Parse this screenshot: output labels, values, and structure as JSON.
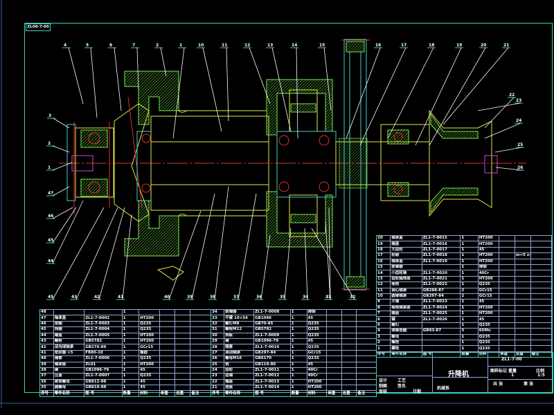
{
  "drawing_number_tag": "ZL00-7-00",
  "colors": {
    "background": "#000000",
    "frame": "#3fd0c8",
    "section_hatch": "#7de84c",
    "outline": "#e8e84c",
    "centerline": "#e03030",
    "grid": "#8ea8d8"
  },
  "callouts": [
    "4",
    "5",
    "6",
    "7",
    "2",
    "1",
    "10",
    "11",
    "12",
    "13",
    "14",
    "15",
    "16",
    "17",
    "18",
    "19",
    "20",
    "21",
    "22",
    "23",
    "24",
    "25",
    "26",
    "3",
    "2",
    "1",
    "47",
    "46",
    "45",
    "44",
    "45",
    "43",
    "42",
    "41",
    "40",
    "39",
    "38",
    "37",
    "36",
    "35",
    "34",
    "33",
    "32",
    "31"
  ],
  "parts_table_left": {
    "rows": [
      [
        "48",
        "",
        "",
        "1",
        "",
        "",
        ""
      ],
      [
        "47",
        "轴承盖",
        "ZL1-7-0002",
        "1",
        "HT200",
        "",
        ""
      ],
      [
        "46",
        "垫圈",
        "ZL1-7-0003",
        "1",
        "Q235",
        "",
        ""
      ],
      [
        "45",
        "挡圈",
        "ZL1-7-0004",
        "1",
        "Q235",
        "",
        ""
      ],
      [
        "44",
        "端盖",
        "ZL1-7-0005",
        "1",
        "HT200",
        "",
        ""
      ],
      [
        "43",
        "螺栓",
        "GB5782",
        "1",
        "HT200",
        "",
        ""
      ],
      [
        "42",
        "深沟球轴承",
        "GB276-89",
        "1",
        "GCr15",
        "",
        ""
      ],
      [
        "41",
        "密封圈 ×5",
        "FB80-10",
        "1",
        "橡胶",
        "",
        ""
      ],
      [
        "40",
        "隔套",
        "ZL1-7-0006",
        "1",
        "Q235",
        "",
        ""
      ],
      [
        "39",
        "轴承座",
        "ZL01",
        "1",
        "HT200",
        "",
        ""
      ],
      [
        "38",
        "键",
        "GB1096-79",
        "1",
        "45",
        "",
        ""
      ],
      [
        "37",
        "压盖",
        "ZL1-7-0007",
        "1",
        "Q235",
        "",
        ""
      ],
      [
        "36",
        "套筒螺母",
        "GB812-88",
        "1",
        "45",
        "",
        ""
      ],
      [
        "35",
        "圆螺母",
        "GB810-88",
        "1",
        "45",
        "",
        ""
      ]
    ],
    "header": [
      "序号",
      "零件名称",
      "图 号",
      "数量",
      "材料",
      "单重",
      "总重",
      "备注"
    ]
  },
  "parts_table_middle": {
    "rows": [
      [
        "34",
        "联轴器",
        "ZL1-7-0008",
        "1",
        "铸钢",
        "",
        ""
      ],
      [
        "33",
        "平键 10×56",
        "GB1096",
        "1",
        "45",
        "",
        ""
      ],
      [
        "32",
        "螺钉M8",
        "GB70-85",
        "1",
        "Q235",
        "",
        ""
      ],
      [
        "31",
        "螺栓M12",
        "GB5782",
        "1",
        "Q235",
        "",
        ""
      ],
      [
        "30",
        "挡板",
        "ZL1-7-0009",
        "1",
        "Q235",
        "",
        ""
      ],
      [
        "29",
        "键",
        "GB1096-79",
        "1",
        "45",
        "",
        ""
      ],
      [
        "28",
        "隔套",
        "ZL1-7-0010",
        "1",
        "Q235",
        "",
        ""
      ],
      [
        "27",
        "滚动轴承",
        "GB297-84",
        "1",
        "GCr15",
        "",
        ""
      ],
      [
        "26",
        "螺母M16",
        "GB6170",
        "1",
        "Q235",
        "",
        ""
      ],
      [
        "25",
        "销",
        "GB119-86",
        "1",
        "45",
        "",
        ""
      ],
      [
        "24",
        "齿轮",
        "ZL1-7-0011",
        "1",
        "40Cr",
        "",
        ""
      ],
      [
        "23",
        "齿轴",
        "ZL1-7-0012",
        "1",
        "40Cr",
        "",
        ""
      ],
      [
        "22",
        "端盖",
        "ZL1-7-0013",
        "1",
        "HT200",
        "",
        ""
      ],
      [
        "21",
        "透盖",
        "ZL1-7-0014",
        "1",
        "HT200",
        "",
        ""
      ]
    ],
    "header": [
      "序号",
      "零件名称",
      "图 号",
      "数量",
      "材料",
      "单重",
      "总重",
      "备注"
    ]
  },
  "parts_table_right": {
    "rows": [
      [
        "20",
        "轴承盖",
        "ZL1-7-0015",
        "1",
        "HT200",
        "",
        ""
      ],
      [
        "19",
        "端盖",
        "ZL1-7-0016",
        "1",
        "HT200",
        "",
        ""
      ],
      [
        "18",
        "大齿轮",
        "ZL1-7-0017",
        "1",
        "45",
        "",
        ""
      ],
      [
        "17",
        "轮毂",
        "ZL1-7-0018",
        "1",
        "HT200",
        "",
        "m=5 z=77"
      ],
      [
        "16",
        "轴承盖",
        "ZL1-7-0019",
        "1",
        "HT200",
        "",
        ""
      ],
      [
        "15",
        "联轴器",
        "",
        "1",
        "铸钢",
        "",
        ""
      ],
      [
        "14",
        "小齿轮轴",
        "ZL1-7-0020",
        "1",
        "40Cr",
        "",
        ""
      ],
      [
        "13",
        "齿轮箱体座",
        "ZL1-7-0021",
        "1",
        "HT200",
        "",
        ""
      ],
      [
        "12",
        "卷筒",
        "ZL1-7-0022",
        "1",
        "Q235",
        "",
        ""
      ],
      [
        "11",
        "调心轴承",
        "GB288-87",
        "2",
        "GCr15",
        "",
        ""
      ],
      [
        "10",
        "圆锥轴承",
        "GB297-84",
        "2",
        "GCr15",
        "",
        ""
      ],
      [
        "9",
        "大轴",
        "ZL1-7-0023",
        "1",
        "45",
        "",
        ""
      ],
      [
        "8",
        "卷筒轴承座",
        "ZL1-7-0024",
        "1",
        "HT200",
        "",
        ""
      ],
      [
        "7",
        "端盖",
        "ZL1-7-0025",
        "1",
        "HT200",
        "",
        ""
      ],
      [
        "6",
        "键",
        "ZL1-7-0026",
        "1",
        "45",
        "",
        ""
      ],
      [
        "5",
        "螺钉",
        "",
        "1",
        "Q235",
        "",
        ""
      ],
      [
        "4",
        "弹簧垫圈",
        "GB93-87",
        "3",
        "65Mn",
        "",
        ""
      ],
      [
        "3",
        "螺母",
        "",
        "1",
        "Q235",
        "",
        ""
      ],
      [
        "2",
        "螺栓",
        "",
        "1",
        "Q235",
        "",
        ""
      ],
      [
        "1",
        "螺栓",
        "",
        "1",
        "Q235",
        "",
        ""
      ]
    ],
    "header": [
      "序号",
      "零件名称",
      "图 号",
      "数量",
      "材料",
      "单重",
      "总重",
      "备注"
    ]
  },
  "title_block": {
    "drawing_code": "ZL1-7-00",
    "title": "升降机",
    "subtitle": "图样标记",
    "mark_label": "标记",
    "weight_label": "重量",
    "scale_label": "比例",
    "scale_value": "1",
    "sheet_label": "共 张",
    "sheet_of": "第 张",
    "sheet_total": "1:5",
    "design_label": "设计",
    "draw_label": "制图",
    "check_label": "审核",
    "process_label": "工艺",
    "date_label": "日期",
    "sign_label": "签名",
    "school": "机械系"
  }
}
